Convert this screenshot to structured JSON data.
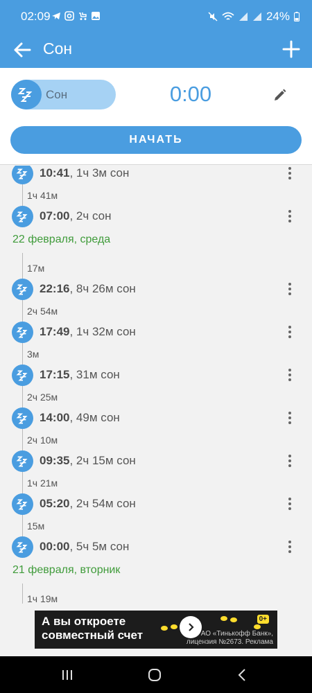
{
  "status_bar": {
    "time": "02:09",
    "battery": "24%",
    "left_icons": [
      "telegram-icon",
      "instagram-icon",
      "stroller-icon",
      "gallery-icon"
    ],
    "right_icons": [
      "mute-icon",
      "wifi-icon",
      "signal-icon",
      "signal-icon",
      "battery-icon"
    ]
  },
  "app_bar": {
    "title": "Сон"
  },
  "controls": {
    "toggle_label": "Сон",
    "timer": "0:00",
    "start_button": "НАЧАТЬ"
  },
  "timeline": {
    "entries": [
      {
        "time": "10:41",
        "detail": ", 1ч 3м сон"
      },
      {
        "gap": "1ч 41м"
      },
      {
        "time": "07:00",
        "detail": ", 2ч сон"
      },
      {
        "date": "22 февраля, среда"
      },
      {
        "gap": "17м"
      },
      {
        "time": "22:16",
        "detail": ", 8ч 26м сон"
      },
      {
        "gap": "2ч 54м"
      },
      {
        "time": "17:49",
        "detail": ", 1ч 32м сон"
      },
      {
        "gap": "3м"
      },
      {
        "time": "17:15",
        "detail": ", 31м сон"
      },
      {
        "gap": "2ч 25м"
      },
      {
        "time": "14:00",
        "detail": ", 49м сон"
      },
      {
        "gap": "2ч 10м"
      },
      {
        "time": "09:35",
        "detail": ", 2ч 15м сон"
      },
      {
        "gap": "1ч 21м"
      },
      {
        "time": "05:20",
        "detail": ", 2ч 54м сон"
      },
      {
        "gap": "15м"
      },
      {
        "time": "00:00",
        "detail": ", 5ч 5м сон"
      },
      {
        "date": "21 февраля, вторник"
      },
      {
        "gap": "1ч 19м"
      }
    ]
  },
  "ad": {
    "title": "А вы откроете совместный счет",
    "age": "0+",
    "legal": "АО «Тинькофф Банк», лицензия №2673. Реклама"
  },
  "colors": {
    "primary": "#4a9de0",
    "toggle_track": "#a6d2f4",
    "date_header": "#3f9b3a"
  }
}
